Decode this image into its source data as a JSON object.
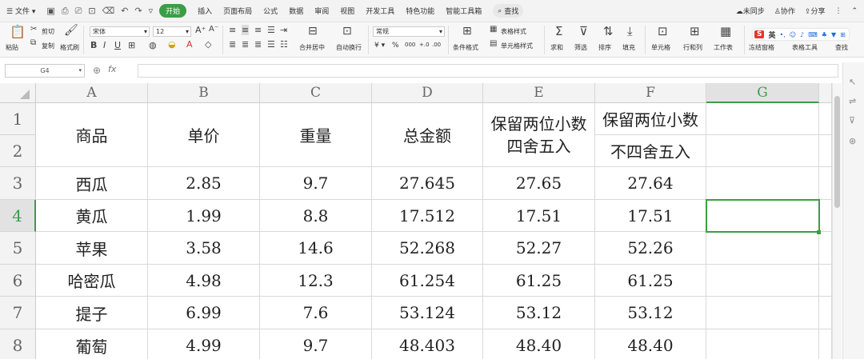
{
  "menubar": {
    "file": "文件",
    "tabs": [
      "开始",
      "插入",
      "页面布局",
      "公式",
      "数据",
      "审阅",
      "视图",
      "开发工具",
      "特色功能",
      "智能工具箱"
    ],
    "search": "查找",
    "unsynced": "未同步",
    "collab": "协作",
    "share": "分享"
  },
  "toolbar": {
    "paste": "粘贴",
    "cut": "剪切",
    "copy": "复制",
    "format_painter": "格式刷",
    "font_name": "宋体",
    "font_size": "12",
    "merge_center": "合并居中",
    "wrap": "自动换行",
    "number_format": "常规",
    "conditional_format": "条件格式",
    "table_style": "表格样式",
    "cell_style": "单元格样式",
    "sum": "求和",
    "filter": "筛选",
    "sort": "排序",
    "fill": "填充",
    "cell": "单元格",
    "row_col": "行和列",
    "worksheet": "工作表",
    "freeze": "冻结窗格",
    "table_tools": "表格工具",
    "find": "查找",
    "ime": "英"
  },
  "formula_bar": {
    "name_box": "G4",
    "fx": "fx",
    "content": ""
  },
  "sheet": {
    "columns": [
      "A",
      "B",
      "C",
      "D",
      "E",
      "F",
      "G"
    ],
    "rows": [
      "1",
      "2",
      "3",
      "4",
      "5",
      "6",
      "7",
      "8"
    ],
    "header": {
      "a": "商品",
      "b": "单价",
      "c": "重量",
      "d": "总金额",
      "e": "保留两位小数四舍五入",
      "f1": "保留两位小数",
      "f2": "不四舍五入"
    },
    "data": [
      [
        "西瓜",
        "2.85",
        "9.7",
        "27.645",
        "27.65",
        "27.64"
      ],
      [
        "黄瓜",
        "1.99",
        "8.8",
        "17.512",
        "17.51",
        "17.51"
      ],
      [
        "苹果",
        "3.58",
        "14.6",
        "52.268",
        "52.27",
        "52.26"
      ],
      [
        "哈密瓜",
        "4.98",
        "12.3",
        "61.254",
        "61.25",
        "61.25"
      ],
      [
        "提子",
        "6.99",
        "7.6",
        "53.124",
        "53.12",
        "53.12"
      ],
      [
        "葡萄",
        "4.99",
        "9.7",
        "48.403",
        "48.40",
        "48.40"
      ]
    ]
  }
}
